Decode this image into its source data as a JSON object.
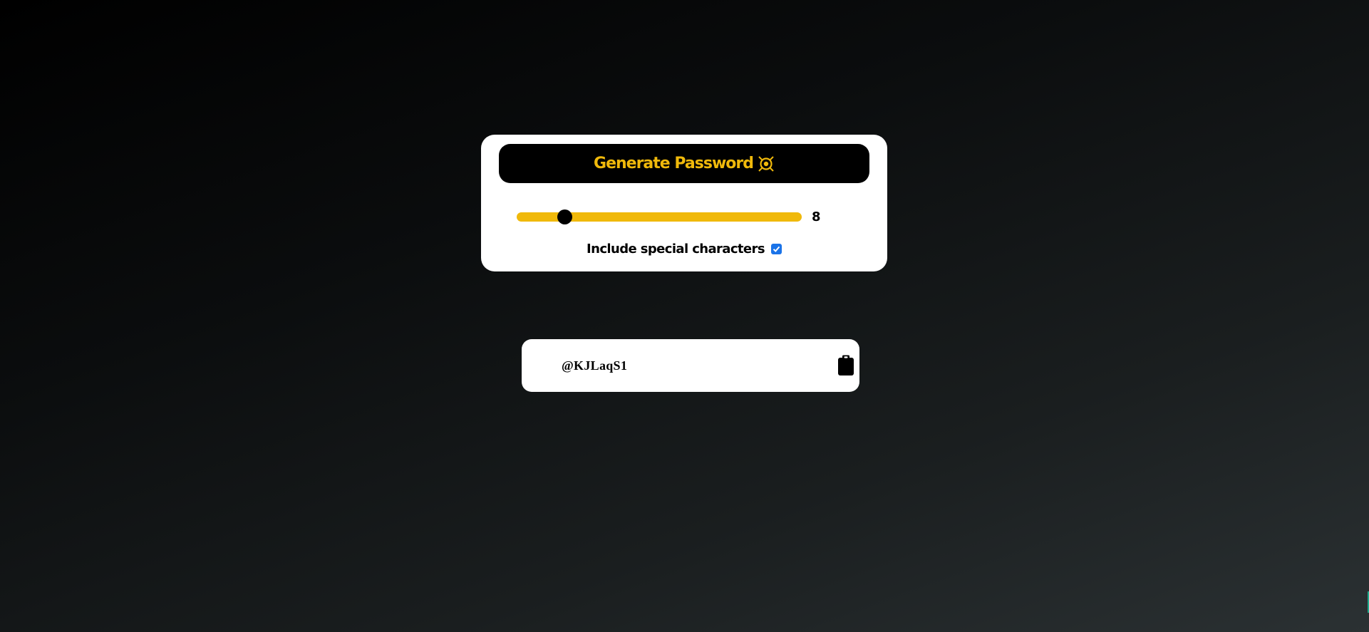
{
  "generator": {
    "button_label": "Generate Password",
    "button_icon": "bitcoin-coin-icon",
    "length_slider": {
      "value": 8,
      "min": 4,
      "max": 28
    },
    "special_characters": {
      "label": "Include special characters",
      "checked": true
    }
  },
  "output": {
    "password": "@KJLaqS1",
    "copy_icon": "clipboard-icon"
  },
  "colors": {
    "accent": "#f0b90b",
    "card": "#ffffff",
    "button_bg": "#000000",
    "checkbox": "#1a73e8"
  }
}
